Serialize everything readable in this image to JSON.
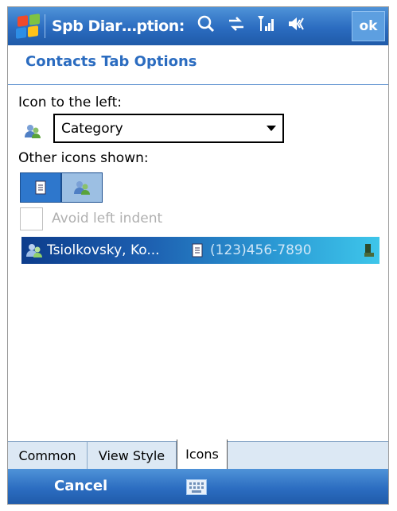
{
  "titlebar": {
    "title": "Spb Diar…ption:",
    "icons": [
      "windows-start-icon",
      "search-icon",
      "connectivity-icon",
      "signal-icon",
      "volume-icon"
    ],
    "ok_label": "ok"
  },
  "page": {
    "title": "Contacts Tab Options"
  },
  "icon_left": {
    "label": "Icon to the left:",
    "selected": "Category"
  },
  "other_icons": {
    "label": "Other icons shown:",
    "toggles": [
      "note-icon",
      "category-icon"
    ]
  },
  "avoid_indent": {
    "label": "Avoid left indent",
    "checked": false
  },
  "preview": {
    "name": "Tsiolkovsky, Ko...",
    "phone": "(123)456-7890"
  },
  "tabs": [
    {
      "label": "Common",
      "active": false
    },
    {
      "label": "View Style",
      "active": false
    },
    {
      "label": "Icons",
      "active": true
    }
  ],
  "softkeys": {
    "left": "Cancel"
  },
  "colors": {
    "accent": "#2b6cc0",
    "title_text": "#2b6cc0"
  }
}
